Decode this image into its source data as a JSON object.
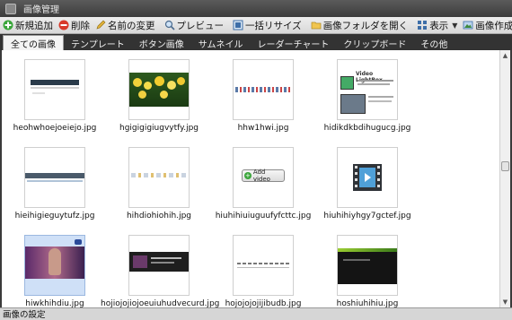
{
  "window": {
    "title": "画像管理"
  },
  "toolbar": {
    "add": "新規追加",
    "delete": "削除",
    "rename": "名前の変更",
    "preview": "プレビュー",
    "batch_resize": "一括リサイズ",
    "open_folder": "画像フォルダを開く",
    "view": "表示",
    "create_image": "画像作成"
  },
  "tabs": [
    "全ての画像",
    "テンプレート",
    "ボタン画像",
    "サムネイル",
    "レーダーチャート",
    "クリップボード",
    "その他"
  ],
  "images": [
    {
      "name": "heohwhoejoeiejo.jpg"
    },
    {
      "name": "hgigigigiugvytfy.jpg"
    },
    {
      "name": "hhw1hwi.jpg"
    },
    {
      "name": "hidikdkbdihugucg.jpg"
    },
    {
      "name": "hieihigieguytufz.jpg"
    },
    {
      "name": "hihdiohiohih.jpg"
    },
    {
      "name": "hiuhihiuiuguufyfcttc.jpg"
    },
    {
      "name": "hiuhihiyhgy7gctef.jpg"
    },
    {
      "name": "hiwkhihdiu.jpg"
    },
    {
      "name": "hojiojojiojoeuiuhudvecurd.jpg"
    },
    {
      "name": "hojojojojijibudb.jpg"
    },
    {
      "name": "hoshiuhihiu.jpg"
    }
  ],
  "thumb_text": {
    "add_video": "Add video",
    "video_lightbox": "Video LightBox"
  },
  "status": {
    "text": "画像の設定"
  }
}
